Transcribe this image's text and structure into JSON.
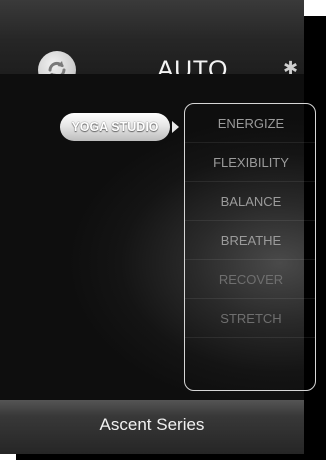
{
  "header": {
    "mode_label": "AUTO",
    "sync_icon": "sync-icon",
    "bluetooth_icon": "bluetooth-icon",
    "bluetooth_glyph": "✱"
  },
  "program": {
    "selected_label": "YOGA STUDIO",
    "arrow_icon": "triangle-right-icon"
  },
  "menu": {
    "items": [
      {
        "label": "ENERGIZE"
      },
      {
        "label": "FLEXIBILITY"
      },
      {
        "label": "BALANCE"
      },
      {
        "label": "BREATHE"
      },
      {
        "label": "RECOVER"
      },
      {
        "label": "STRETCH"
      }
    ]
  },
  "footer": {
    "series_label": "Ascent Series"
  },
  "colors": {
    "active_text": "#ffffff",
    "menu_text": "#9b9b9b",
    "panel_border": "#d6d6d6"
  }
}
